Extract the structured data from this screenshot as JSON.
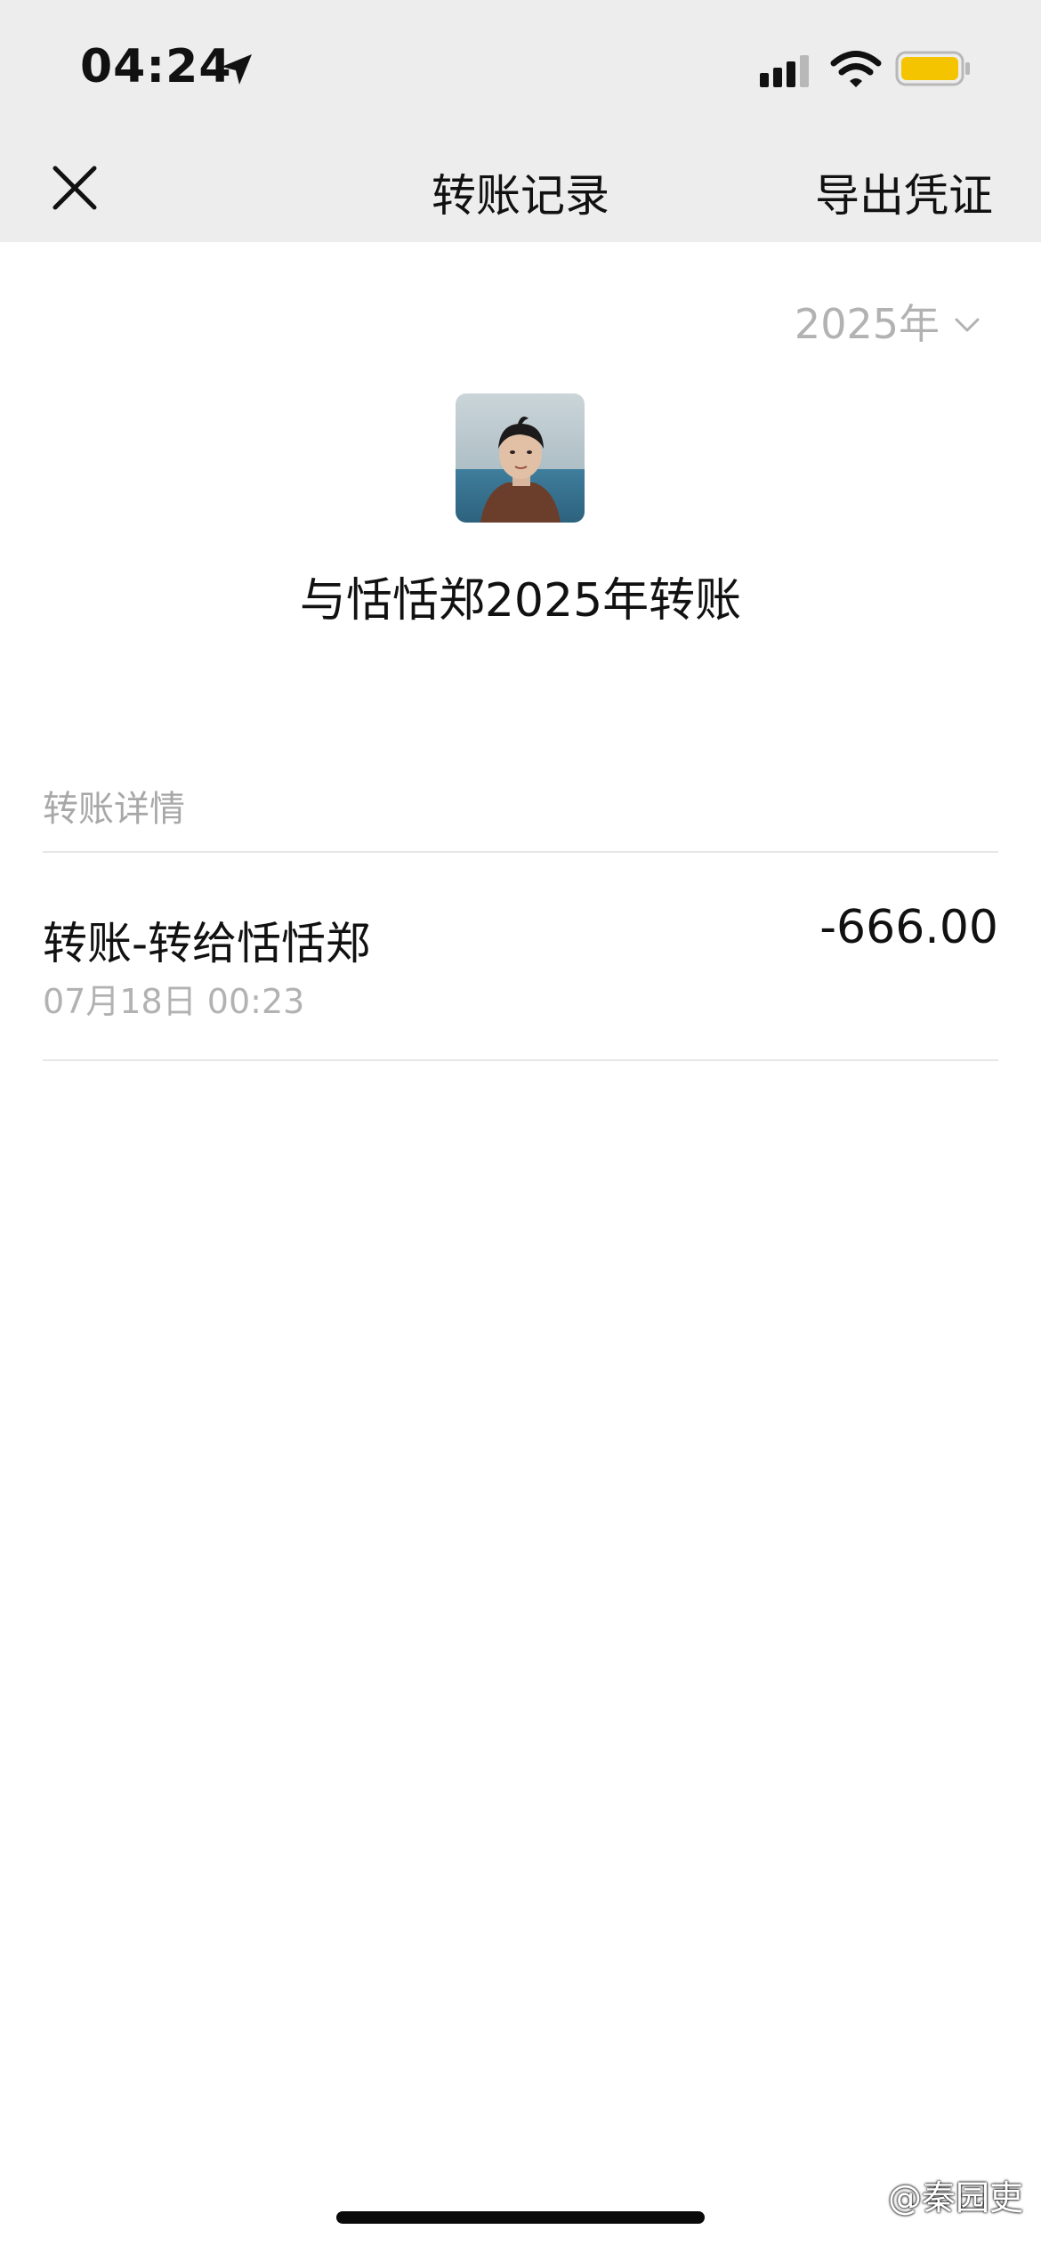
{
  "status_bar": {
    "time": "04:24",
    "icons": [
      "location-arrow-icon",
      "cellular-signal-icon",
      "wifi-icon",
      "battery-icon"
    ],
    "battery_color": "#f5c400"
  },
  "nav": {
    "title": "转账记录",
    "close_icon": "close-icon",
    "export_label": "导出凭证"
  },
  "filter": {
    "year_label": "2025年",
    "icon": "chevron-down-icon"
  },
  "summary": {
    "title": "与恬恬郑2025年转账"
  },
  "section": {
    "label": "转账详情"
  },
  "transactions": [
    {
      "title": "转账-转给恬恬郑",
      "time": "07月18日 00:23",
      "amount": "-666.00"
    }
  ],
  "watermark": {
    "text": "@秦园吏"
  }
}
